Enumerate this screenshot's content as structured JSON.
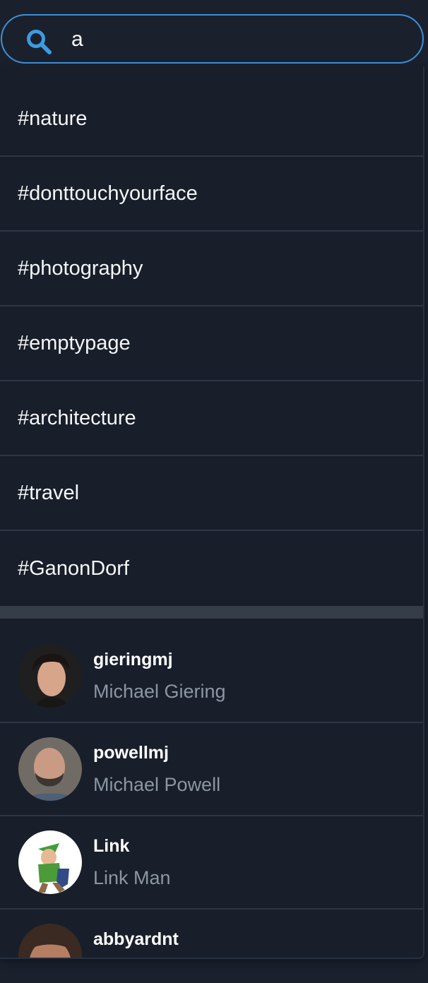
{
  "search": {
    "value": "a",
    "icon": "search-icon"
  },
  "colors": {
    "background": "#1a212d",
    "border_accent": "#3d8fd8",
    "muted_text": "#8c96a3"
  },
  "hashtags": [
    "#nature",
    "#donttouchyourface",
    "#photography",
    "#emptypage",
    "#architecture",
    "#travel",
    "#GanonDorf"
  ],
  "users": [
    {
      "username": "gieringmj",
      "name": "Michael Giering"
    },
    {
      "username": "powellmj",
      "name": "Michael Powell"
    },
    {
      "username": "Link",
      "name": "Link Man"
    },
    {
      "username": "abbyardnt",
      "name": ""
    }
  ]
}
